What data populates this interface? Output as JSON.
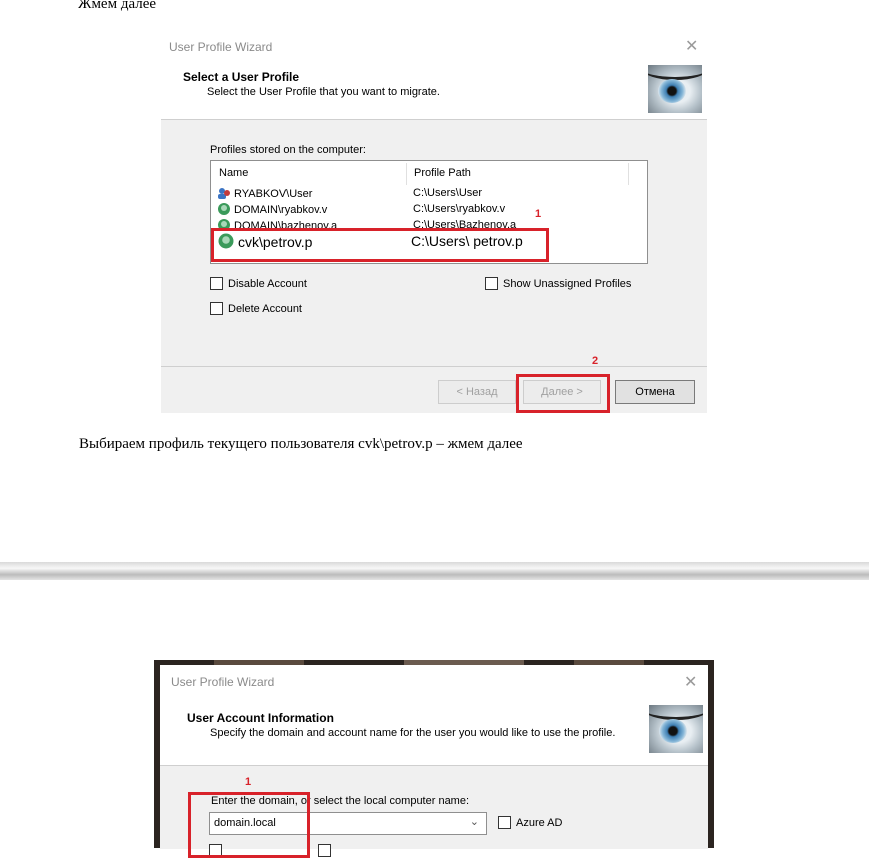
{
  "captions": {
    "top": "Жмем далее",
    "middle": "Выбираем профиль текущего пользователя cvk\\petrov.p – жмем далее"
  },
  "dialog1": {
    "title": "User Profile Wizard",
    "close_glyph": "✕",
    "heading": "Select a User Profile",
    "subheading": "Select the User Profile that you want to migrate.",
    "profiles_label": "Profiles stored on the computer:",
    "columns": {
      "name": "Name",
      "path": "Profile Path"
    },
    "rows": [
      {
        "name": "RYABKOV\\User",
        "path": "C:\\Users\\User"
      },
      {
        "name": "DOMAIN\\ryabkov.v",
        "path": "C:\\Users\\ryabkov.v"
      },
      {
        "name": "DOMAIN\\bazhenov.a",
        "path": "C:\\Users\\Bazhenov.a"
      },
      {
        "name": "cvk\\petrov.p",
        "path": "C:\\Users\\ petrov.p"
      }
    ],
    "checkboxes": {
      "disable_account": "Disable Account",
      "delete_account": "Delete Account",
      "show_unassigned": "Show Unassigned Profiles"
    },
    "buttons": {
      "back": "< Назад",
      "next": "Далее >",
      "cancel": "Отмена"
    },
    "markers": {
      "one": "1",
      "two": "2"
    }
  },
  "dialog2": {
    "title": "User Profile Wizard",
    "close_glyph": "✕",
    "heading": "User Account Information",
    "subheading": "Specify the domain and account name for the user you would like to use the profile.",
    "domain_label": "Enter the domain, or select the local computer name:",
    "domain_value": "domain.local",
    "azure_label": "Azure AD",
    "marker": "1"
  },
  "colors": {
    "highlight": "#d8222a",
    "panel": "#f0f0f0"
  },
  "icons": [
    "user-profile-icon",
    "close-icon",
    "eye-logo-icon",
    "dropdown-arrow-icon"
  ]
}
